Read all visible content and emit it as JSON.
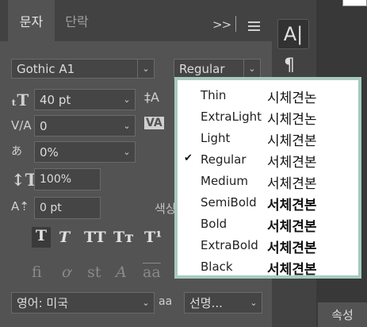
{
  "tabs": {
    "character": "문자",
    "paragraph": "단락"
  },
  "panel_controls": {
    "collapse": ">>"
  },
  "font_family": "Gothic A1",
  "font_style": "Regular",
  "size": {
    "value": "40 pt"
  },
  "kerning": {
    "value": "0"
  },
  "tsume": {
    "value": "0%"
  },
  "vertical_scale": {
    "value": "100%"
  },
  "baseline_shift": {
    "value": "0 pt"
  },
  "color_label": "색상",
  "language": "영어: 미국",
  "antialias_icon_label": "aa",
  "antialias": "선명...",
  "properties_tab": "속성",
  "tool_glyph": "A|",
  "para_glyph": "¶",
  "style_buttons": {
    "faux_bold": "T",
    "faux_italic": "T",
    "all_caps": "TT",
    "small_caps": "Tт",
    "superscript": "T¹"
  },
  "opentype_buttons": {
    "ligatures": "fi",
    "alt_ligatures": "ơ",
    "discretionary": "st",
    "swash": "A",
    "titling": "aa"
  },
  "weights": [
    {
      "name": "Thin",
      "sample": "시체견논",
      "checked": false,
      "weight": "200"
    },
    {
      "name": "ExtraLight",
      "sample": "시체견논",
      "checked": false,
      "weight": "200"
    },
    {
      "name": "Light",
      "sample": "시체견본",
      "checked": false,
      "weight": "300"
    },
    {
      "name": "Regular",
      "sample": "서체견본",
      "checked": true,
      "weight": "400"
    },
    {
      "name": "Medium",
      "sample": "서체견본",
      "checked": false,
      "weight": "500"
    },
    {
      "name": "SemiBold",
      "sample": "서체견본",
      "checked": false,
      "weight": "600"
    },
    {
      "name": "Bold",
      "sample": "서체견본",
      "checked": false,
      "weight": "700"
    },
    {
      "name": "ExtraBold",
      "sample": "서체견본",
      "checked": false,
      "weight": "800"
    },
    {
      "name": "Black",
      "sample": "서체견본",
      "checked": false,
      "weight": "900"
    }
  ],
  "check_glyph": "✔",
  "colors": {
    "popup_border": "#a6cbbd",
    "panel": "#535353",
    "tabbar": "#424242"
  }
}
